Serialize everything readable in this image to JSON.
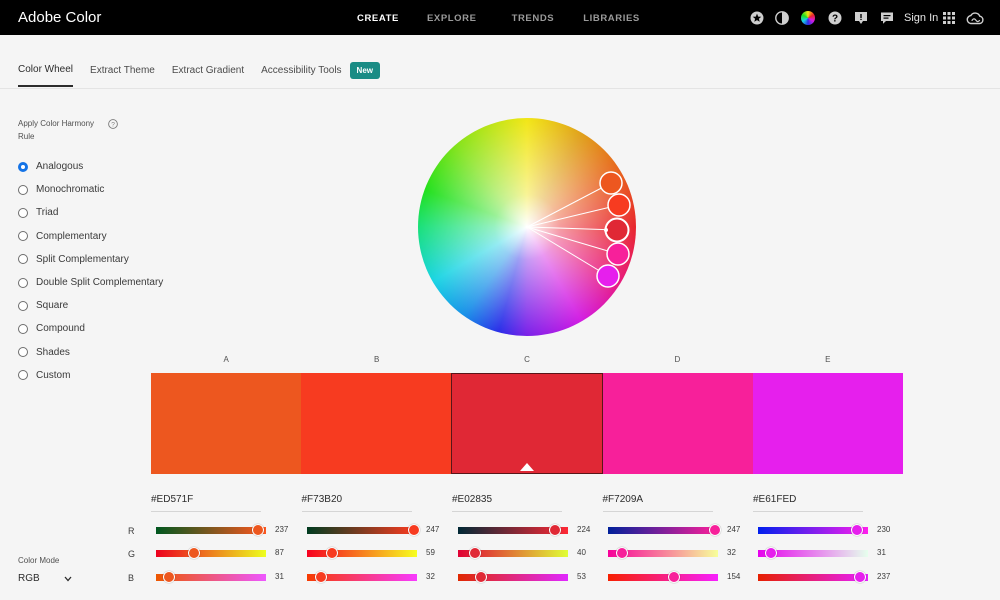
{
  "app": {
    "title": "Adobe Color"
  },
  "nav": [
    {
      "label": "CREATE",
      "active": true
    },
    {
      "label": "EXPLORE",
      "active": false
    },
    {
      "label": "TRENDS",
      "active": false
    },
    {
      "label": "LIBRARIES",
      "active": false
    }
  ],
  "header_icons": [
    "star-badge-icon",
    "theme-toggle-icon",
    "color-wheel-icon",
    "help-icon",
    "feedback-icon",
    "chat-icon",
    "apps-grid-icon",
    "creative-cloud-icon"
  ],
  "sign_in": "Sign In",
  "tabs": [
    {
      "label": "Color Wheel",
      "active": true
    },
    {
      "label": "Extract Theme",
      "active": false
    },
    {
      "label": "Extract Gradient",
      "active": false
    },
    {
      "label": "Accessibility Tools",
      "active": false
    }
  ],
  "new_badge": "New",
  "harmony": {
    "title": "Apply Color Harmony Rule",
    "selected": "Analogous",
    "rules": [
      "Analogous",
      "Monochromatic",
      "Triad",
      "Complementary",
      "Split Complementary",
      "Double Split Complementary",
      "Square",
      "Compound",
      "Shades",
      "Custom"
    ]
  },
  "color_mode": {
    "label": "Color Mode",
    "value": "RGB"
  },
  "swatches": [
    {
      "label": "A",
      "hex": "#ED571F",
      "rgb": [
        237,
        87,
        31
      ]
    },
    {
      "label": "B",
      "hex": "#F73B20",
      "rgb": [
        247,
        59,
        32
      ]
    },
    {
      "label": "C",
      "hex": "#E02835",
      "rgb": [
        224,
        40,
        53
      ]
    },
    {
      "label": "D",
      "hex": "#F7209A",
      "rgb": [
        247,
        32,
        154
      ]
    },
    {
      "label": "E",
      "hex": "#E61FED",
      "rgb": [
        230,
        31,
        237
      ]
    }
  ],
  "selected_swatch": 2,
  "channels": [
    "R",
    "G",
    "B"
  ],
  "colors": {
    "accent": "#1473e6",
    "badge": "#1a8c85",
    "topbar": "#000000"
  }
}
